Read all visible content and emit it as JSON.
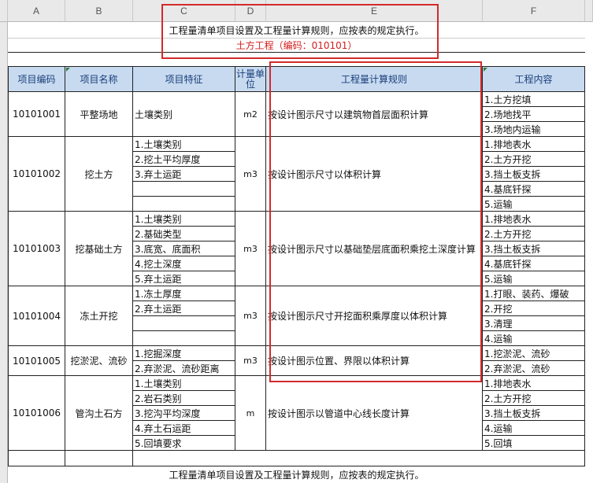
{
  "columns": [
    "A",
    "B",
    "C",
    "D",
    "E",
    "F"
  ],
  "title_line": "工程量清单项目设置及工程量计算规则，应按表的规定执行。",
  "subtitle_line": "土方工程（编码：010101）",
  "headers": {
    "code": "项目编码",
    "name": "项目名称",
    "feature": "项目特征",
    "unit": "计量单位",
    "rule": "工程量计算规则",
    "content": "工程内容"
  },
  "rows": [
    {
      "code": "10101001",
      "name": "平整场地",
      "features": [
        "土壤类别"
      ],
      "unit": "m2",
      "rule": "按设计图示尺寸以建筑物首层面积计算",
      "contents": [
        "1.土方挖填",
        "2.场地找平",
        "3.场地内运输"
      ]
    },
    {
      "code": "10101002",
      "name": "挖土方",
      "features": [
        "1.土壤类别",
        "2.挖土平均厚度",
        "3.弃土运距",
        "",
        ""
      ],
      "unit": "m3",
      "rule": "按设计图示尺寸以体积计算",
      "contents": [
        "1.排地表水",
        "2.土方开挖",
        "3.挡土板支拆",
        "4.基底钎探",
        "5.运输"
      ]
    },
    {
      "code": "10101003",
      "name": "挖基础土方",
      "features": [
        "1.土壤类别",
        "2.基础类型",
        "3.底宽、底面积",
        "4.挖土深度",
        "5.弃土运距"
      ],
      "unit": "m3",
      "rule": "按设计图示尺寸以基础垫层底面积乘挖土深度计算",
      "contents": [
        "1.排地表水",
        "2.土方开挖",
        "3.挡土板支拆",
        "4.基底钎探",
        "5.运输"
      ]
    },
    {
      "code": "10101004",
      "name": "冻土开挖",
      "features": [
        "1.冻土厚度",
        "2.弃土运距",
        "",
        ""
      ],
      "unit": "m3",
      "rule": "按设计图示尺寸开挖面积乘厚度以体积计算",
      "contents": [
        "1.打眼、装药、爆破",
        "2.开挖",
        "3.清理",
        "4.运输"
      ]
    },
    {
      "code": "10101005",
      "name": "挖淤泥、流砂",
      "features": [
        "1.挖掘深度",
        "2.弃淤泥、流砂距离"
      ],
      "unit": "m3",
      "rule": "按设计图示位置、界限以体积计算",
      "contents": [
        "1.挖淤泥、流砂",
        "2.弃淤泥、流砂"
      ]
    },
    {
      "code": "10101006",
      "name": "管沟土石方",
      "features": [
        "1.土壤类别",
        "2.岩石类别",
        "3.挖沟平均深度",
        "4.弃土石运距",
        "5.回填要求"
      ],
      "unit": "m",
      "rule": "按设计图示以管道中心线长度计算",
      "contents": [
        "1.排地表水",
        "2.土方开挖",
        "3.挡土板支拆",
        "4.运输",
        "5.回填"
      ]
    }
  ],
  "footer_line": "工程量清单项目设置及工程量计算规则，应按表的规定执行。",
  "colors": {
    "header_fill": "#c7daf0",
    "highlight_box": "#d32a2a",
    "subtitle": "#d21c1c"
  }
}
